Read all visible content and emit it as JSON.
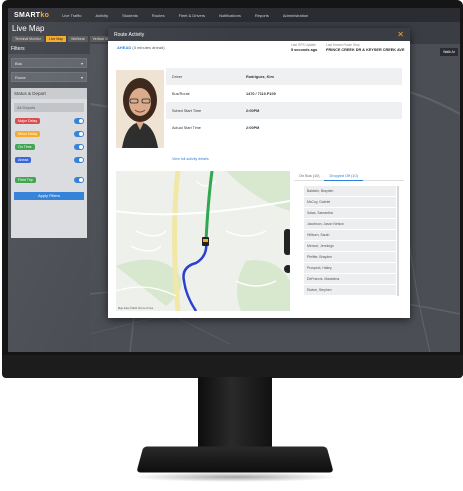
{
  "app": {
    "logo_main": "SMART",
    "logo_suffix": "ko",
    "nav": [
      "Live Traffic",
      "Activity",
      "Students",
      "Routes",
      "Fleet & Drivers",
      "Notifications",
      "Reports",
      "Administration"
    ],
    "page_title": "Live Map",
    "map_tabs": [
      "Terminal Monitor",
      "Live Map",
      "Wellbeat",
      "Vertical Monitor"
    ],
    "active_map_tab": "Live Map",
    "layers_button": "Walk Ar"
  },
  "sidebar": {
    "filters_label": "Filters",
    "bus_select": "Bus",
    "route_select": "Route",
    "status_panel_title": "Status & Depart",
    "search_placeholder": "All Depots",
    "statuses": [
      {
        "label": "Major Delay",
        "color": "#d64545"
      },
      {
        "label": "Minor Delay",
        "color": "#f5a623"
      },
      {
        "label": "On Time",
        "color": "#39a24a"
      },
      {
        "label": "Ahead",
        "color": "#2f5fd8"
      },
      {
        "label": "Field Trip",
        "color": "#39a24a"
      }
    ],
    "apply_button": "Apply Filters"
  },
  "modal": {
    "title": "Route Activity",
    "close_icon": "close-icon",
    "status_word": "AHEAD",
    "status_detail": "(3 minutes ahead)",
    "gps_label": "Last GPS Update",
    "gps_value": "5 seconds ago",
    "stop_label": "Last Known Route Stop",
    "stop_value": "PRINCE CREEK DR & KEYSER CREEK AVE",
    "info": [
      {
        "key": "Driver",
        "value": "Rodriguez, Kim"
      },
      {
        "key": "Bus/Route",
        "value": "1470 / 7110.P109"
      },
      {
        "key": "Sched Start Time",
        "value": "2:00PM"
      },
      {
        "key": "Actual Start Time",
        "value": "2:00PM"
      }
    ],
    "full_details_link": "View full activity details",
    "map_attribution": "Map data ©2021 Terms of Use",
    "students_tabs": [
      "On Bus (10)",
      "Dropped Off (10)"
    ],
    "active_students_tab": "Dropped Off (10)",
    "students": [
      "Baldwin, Brayden",
      "McCoy, Gabriel",
      "Salas, Samantha",
      "Jacobson, Jason Nelson",
      "Hillburn, Sarah",
      "Mercuri, Jennings",
      "Pfeiffer, Brayden",
      "Prospect, Hailey",
      "DeFrancis, Madalena",
      "Elwine, Stephen"
    ]
  }
}
